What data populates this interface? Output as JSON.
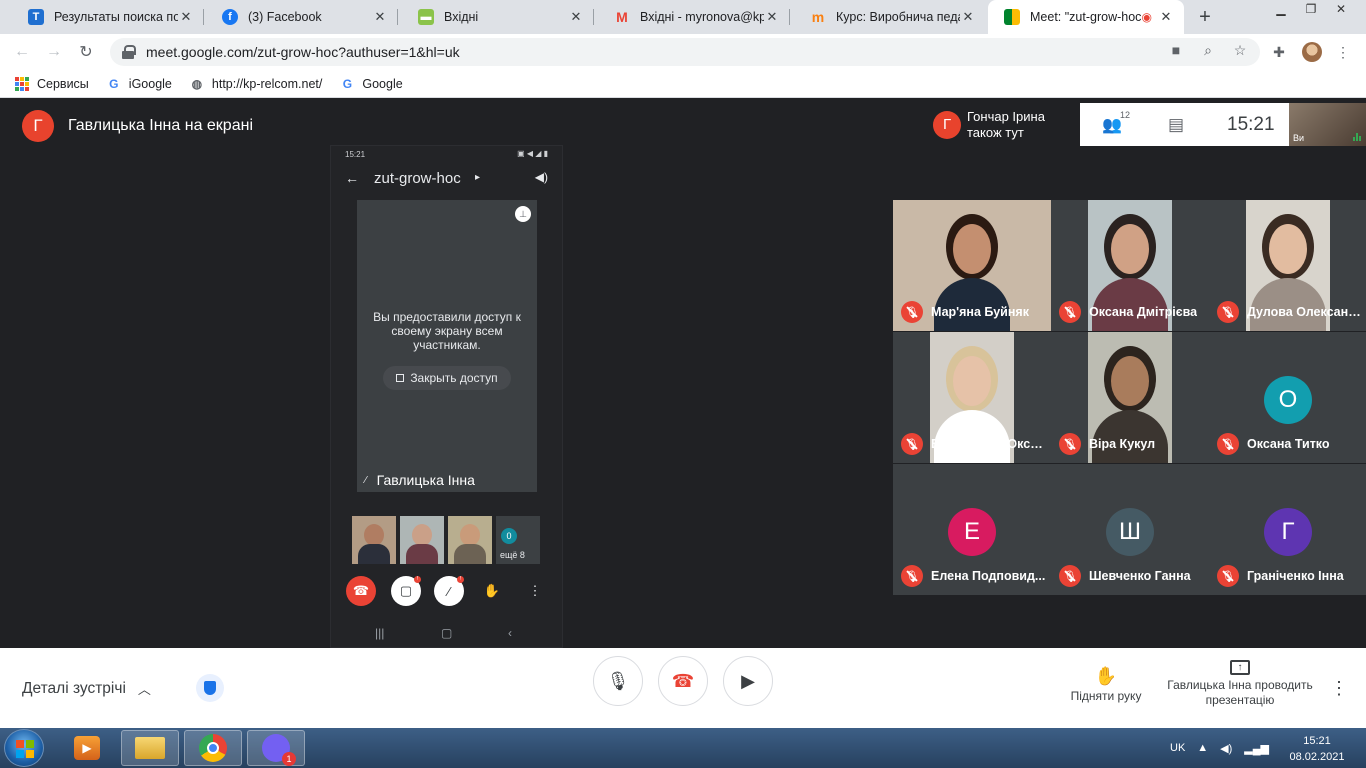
{
  "browser": {
    "tabs": [
      {
        "title": "Результаты поиска по с",
        "favicon": "T",
        "favicon_color": "#1f6fd0",
        "active": false
      },
      {
        "title": "(3) Facebook",
        "favicon": "f",
        "favicon_color": "#1877f2",
        "active": false
      },
      {
        "title": "Вхідні",
        "favicon": "mail-icon",
        "favicon_color": "#8bc34a",
        "active": false
      },
      {
        "title": "Вхідні - myronova@kpnu",
        "favicon": "M",
        "favicon_color": "#ea4335",
        "active": false
      },
      {
        "title": "Курс: Виробнича педагс",
        "favicon": "m",
        "favicon_color": "#f98012",
        "active": false
      },
      {
        "title": "Meet: \"zut-grow-hoc",
        "favicon": "meet-icon",
        "favicon_color": "#00832d",
        "active": true
      }
    ],
    "url": "meet.google.com/zut-grow-hoc?authuser=1&hl=uk",
    "bookmarks": [
      {
        "label": "Сервисы",
        "icon": "apps-grid-icon"
      },
      {
        "label": "iGoogle",
        "icon": "google-g-icon"
      },
      {
        "label": "http://kp-relcom.net/",
        "icon": "globe-icon"
      },
      {
        "label": "Google",
        "icon": "google-g-icon"
      }
    ]
  },
  "meet": {
    "presenter": {
      "initial": "Г",
      "text": "Гавлицька Інна на екрані",
      "avatar_color": "#e8432d"
    },
    "also_here": {
      "initial": "Г",
      "text_line1": "Гончар Ірина",
      "text_line2": "також тут",
      "avatar_color": "#e8432d"
    },
    "people_count": "12",
    "time": "15:21",
    "self_label": "Ви",
    "shared_screen": {
      "status_time": "15:21",
      "meeting_code": "zut-grow-hoc",
      "message": "Вы предоставили доступ к своему экрану всем участникам.",
      "stop_button": "Закрыть доступ",
      "tile_name": "Гавлицька Інна",
      "more_count": "0",
      "more_label": "ещё 8"
    },
    "participants": [
      {
        "name": "Мар'яна Буйняк",
        "type": "video",
        "bg": "#c9b9a7",
        "skin": "#c48f70",
        "hair": "#2b1a12",
        "cloth": "#1e2a3a"
      },
      {
        "name": "Оксана Дмітрієва",
        "type": "video",
        "bg": "#b9c3c5",
        "skin": "#d0a185",
        "hair": "#2a2220",
        "cloth": "#6a3b45"
      },
      {
        "name": "Дулова Олександ...",
        "type": "video",
        "bg": "#d8d4cc",
        "skin": "#e2bca0",
        "hair": "#3a2b22",
        "cloth": "#9b8f86"
      },
      {
        "name": "Бортовська Окса...",
        "type": "video",
        "bg": "#d3cfc8",
        "skin": "#e6c2a8",
        "hair": "#d8c39a",
        "cloth": "#ffffff"
      },
      {
        "name": "Віра Кукул",
        "type": "video",
        "bg": "#bcbcb2",
        "skin": "#a97c5c",
        "hair": "#2c241e",
        "cloth": "#3b3530"
      },
      {
        "name": "Оксана Титко",
        "type": "avatar",
        "initial": "О",
        "color": "#129eaf"
      },
      {
        "name": "Елена Подповид...",
        "type": "avatar",
        "initial": "Е",
        "color": "#d81b60"
      },
      {
        "name": "Шевченко Ганна",
        "type": "avatar",
        "initial": "Ш",
        "color": "#455a64"
      },
      {
        "name": "Граніченко Інна",
        "type": "avatar",
        "initial": "Г",
        "color": "#5e35b1"
      }
    ],
    "bottom": {
      "details": "Деталі зустрічі",
      "raise_hand": "Підняти руку",
      "presenting": "Гавлицька Інна проводить презентацію"
    }
  },
  "taskbar": {
    "language": "UK",
    "time": "15:21",
    "date": "08.02.2021",
    "viber_badge": "1"
  }
}
